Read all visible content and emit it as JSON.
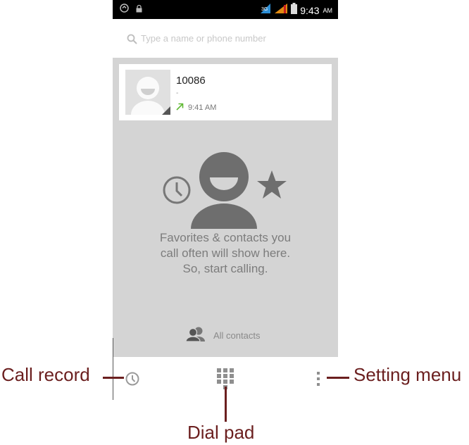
{
  "status_bar": {
    "time": "9:43",
    "ampm": "AM",
    "icons": [
      "sync-icon",
      "lock-icon",
      "signal-sim1-icon",
      "signal-sim2-icon",
      "battery-icon"
    ]
  },
  "search": {
    "placeholder": "Type a name or phone number",
    "icon": "search-icon"
  },
  "recent_call": {
    "name": "10086",
    "detail": "-",
    "time": "9:41 AM",
    "call_type_icon": "outgoing-call-icon",
    "call_type_color": "#5fb832"
  },
  "empty_state": {
    "lines": [
      "Favorites & contacts you",
      "call often will show here.",
      "So, start calling."
    ],
    "icons": [
      "clock-icon",
      "person-icon",
      "star-icon"
    ]
  },
  "all_contacts": {
    "label": "All contacts",
    "icon": "contacts-icon"
  },
  "bottom_bar": {
    "icons": [
      "call-history-icon",
      "dialpad-icon",
      "overflow-menu-icon"
    ]
  },
  "annotations": {
    "call_record": "Call record",
    "dial_pad": "Dial pad",
    "setting_menu": "Setting menu",
    "color": "#6b1f1f"
  }
}
